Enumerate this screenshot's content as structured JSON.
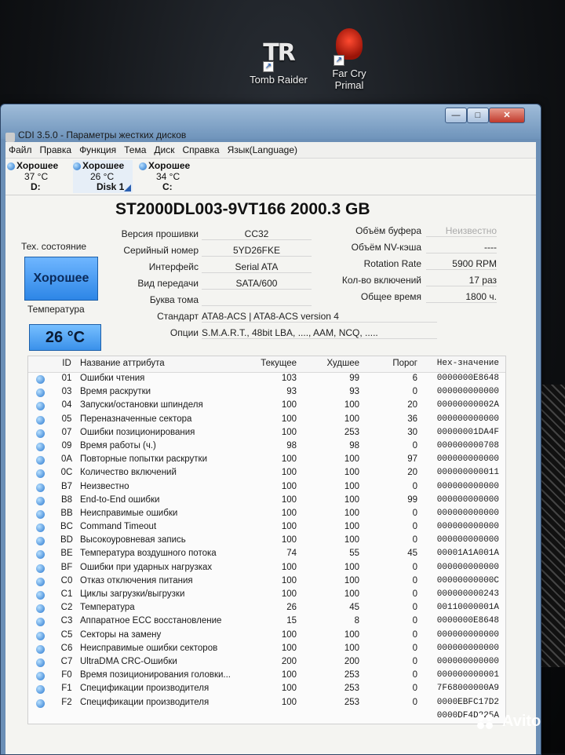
{
  "desktop": {
    "icons": [
      {
        "label": "Tomb Raider",
        "glyph": "TR"
      },
      {
        "label_lines": [
          "Far Cry",
          "Primal"
        ]
      }
    ],
    "watermark": "Avito"
  },
  "window": {
    "title": "CDI 3.5.0 - Параметры жестких дисков",
    "controls": {
      "minimize": "—",
      "maximize": "□",
      "close": "✕"
    }
  },
  "menu": [
    "Файл",
    "Правка",
    "Функция",
    "Тема",
    "Диск",
    "Справка",
    "Язык(Language)"
  ],
  "disks": [
    {
      "status": "Хорошее",
      "temp": "37 °C",
      "drive": "D:"
    },
    {
      "status": "Хорошее",
      "temp": "26 °C",
      "drive": "Disk 1"
    },
    {
      "status": "Хорошее",
      "temp": "34 °C",
      "drive": "C:"
    }
  ],
  "model": "ST2000DL003-9VT166  2000.3 GB",
  "health": {
    "label": "Тех. состояние",
    "value": "Хорошее"
  },
  "temperature": {
    "label": "Температура",
    "value": "26 °C"
  },
  "info_left": [
    {
      "key": "Версия прошивки",
      "value": "CC32"
    },
    {
      "key": "Серийный номер",
      "value": "5YD26FKE"
    },
    {
      "key": "Интерфейс",
      "value": "Serial ATA"
    },
    {
      "key": "Вид передачи",
      "value": "SATA/600"
    },
    {
      "key": "Буква тома",
      "value": ""
    }
  ],
  "info_right": [
    {
      "key": "Объём буфера",
      "value": "Неизвестно"
    },
    {
      "key": "Объём NV-кэша",
      "value": "----"
    },
    {
      "key": "Rotation Rate",
      "value": "5900 RPM"
    },
    {
      "key": "Кол-во включений",
      "value": "17 раз"
    },
    {
      "key": "Общее время",
      "value": "1800 ч."
    }
  ],
  "standard": {
    "key": "Стандарт",
    "value": "ATA8-ACS | ATA8-ACS version 4"
  },
  "options": {
    "key": "Опции",
    "value": "S.M.A.R.T., 48bit LBA, ...., AAM, NCQ, ....."
  },
  "table": {
    "headers": {
      "id": "ID",
      "name": "Название аттрибута",
      "current": "Текущее",
      "worst": "Худшее",
      "threshold": "Порог",
      "raw": "Hex-значение"
    },
    "rows": [
      {
        "id": "01",
        "name": "Ошибки чтения",
        "current": "103",
        "worst": "99",
        "threshold": "6",
        "raw": "0000000E8648"
      },
      {
        "id": "03",
        "name": "Время раскрутки",
        "current": "93",
        "worst": "93",
        "threshold": "0",
        "raw": "000000000000"
      },
      {
        "id": "04",
        "name": "Запуски/остановки шпинделя",
        "current": "100",
        "worst": "100",
        "threshold": "20",
        "raw": "00000000002A"
      },
      {
        "id": "05",
        "name": "Переназначенные сектора",
        "current": "100",
        "worst": "100",
        "threshold": "36",
        "raw": "000000000000"
      },
      {
        "id": "07",
        "name": "Ошибки позиционирования",
        "current": "100",
        "worst": "253",
        "threshold": "30",
        "raw": "00000001DA4F"
      },
      {
        "id": "09",
        "name": "Время работы (ч.)",
        "current": "98",
        "worst": "98",
        "threshold": "0",
        "raw": "000000000708"
      },
      {
        "id": "0A",
        "name": "Повторные попытки раскрутки",
        "current": "100",
        "worst": "100",
        "threshold": "97",
        "raw": "000000000000"
      },
      {
        "id": "0C",
        "name": "Количество включений",
        "current": "100",
        "worst": "100",
        "threshold": "20",
        "raw": "000000000011"
      },
      {
        "id": "B7",
        "name": "Неизвестно",
        "current": "100",
        "worst": "100",
        "threshold": "0",
        "raw": "000000000000"
      },
      {
        "id": "B8",
        "name": "End-to-End ошибки",
        "current": "100",
        "worst": "100",
        "threshold": "99",
        "raw": "000000000000"
      },
      {
        "id": "BB",
        "name": "Неисправимые ошибки",
        "current": "100",
        "worst": "100",
        "threshold": "0",
        "raw": "000000000000"
      },
      {
        "id": "BC",
        "name": "Command Timeout",
        "current": "100",
        "worst": "100",
        "threshold": "0",
        "raw": "000000000000"
      },
      {
        "id": "BD",
        "name": "Высокоуровневая запись",
        "current": "100",
        "worst": "100",
        "threshold": "0",
        "raw": "000000000000"
      },
      {
        "id": "BE",
        "name": "Температура воздушного потока",
        "current": "74",
        "worst": "55",
        "threshold": "45",
        "raw": "00001A1A001A"
      },
      {
        "id": "BF",
        "name": "Ошибки при ударных нагрузках",
        "current": "100",
        "worst": "100",
        "threshold": "0",
        "raw": "000000000000"
      },
      {
        "id": "C0",
        "name": "Отказ отключения питания",
        "current": "100",
        "worst": "100",
        "threshold": "0",
        "raw": "00000000000C"
      },
      {
        "id": "C1",
        "name": "Циклы загрузки/выгрузки",
        "current": "100",
        "worst": "100",
        "threshold": "0",
        "raw": "000000000243"
      },
      {
        "id": "C2",
        "name": "Температура",
        "current": "26",
        "worst": "45",
        "threshold": "0",
        "raw": "00110000001A"
      },
      {
        "id": "C3",
        "name": "Аппаратное ECC восстановление",
        "current": "15",
        "worst": "8",
        "threshold": "0",
        "raw": "0000000E8648"
      },
      {
        "id": "C5",
        "name": "Секторы на замену",
        "current": "100",
        "worst": "100",
        "threshold": "0",
        "raw": "000000000000"
      },
      {
        "id": "C6",
        "name": "Неисправимые ошибки секторов",
        "current": "100",
        "worst": "100",
        "threshold": "0",
        "raw": "000000000000"
      },
      {
        "id": "C7",
        "name": "UltraDMA CRC-Ошибки",
        "current": "200",
        "worst": "200",
        "threshold": "0",
        "raw": "000000000000"
      },
      {
        "id": "F0",
        "name": "Время позиционирования головки...",
        "current": "100",
        "worst": "253",
        "threshold": "0",
        "raw": "000000000001"
      },
      {
        "id": "F1",
        "name": "Спецификации производителя",
        "current": "100",
        "worst": "253",
        "threshold": "0",
        "raw": "7F68000000A9"
      },
      {
        "id": "F2",
        "name": "Спецификации производителя",
        "current": "100",
        "worst": "253",
        "threshold": "0",
        "raw": "0000EBFC17D2"
      },
      {
        "id": "",
        "name": "",
        "current": "",
        "worst": "",
        "threshold": "",
        "raw": "0000DF4D225A"
      }
    ]
  }
}
